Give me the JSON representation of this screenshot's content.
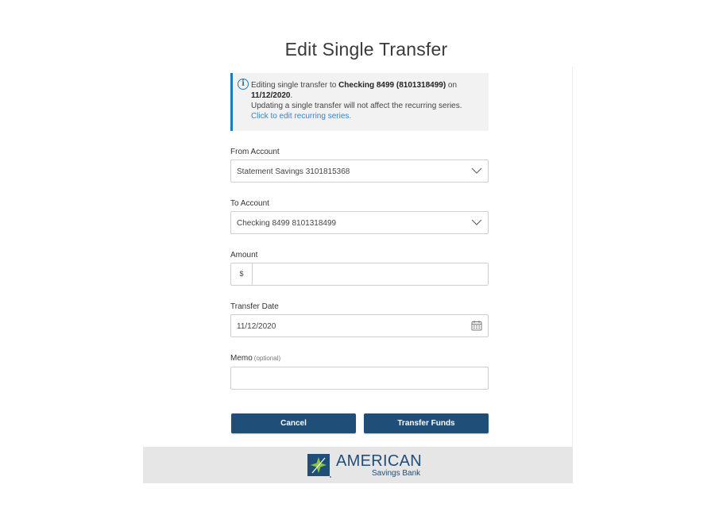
{
  "page": {
    "title": "Edit Single Transfer"
  },
  "notice": {
    "text_prefix": "Editing single transfer to ",
    "account_bold": "Checking 8499 (8101318499)",
    "text_on": " on",
    "date_bold": "11/12/2020",
    "period": ".",
    "line2": "Updating a single transfer will not affect the recurring series. ",
    "link": "Click to edit recurring series."
  },
  "form": {
    "from_label": "From Account",
    "from_value": "Statement Savings 3101815368",
    "to_label": "To Account",
    "to_value": "Checking 8499 8101318499",
    "amount_label": "Amount",
    "amount_prefix": "$",
    "amount_value": "",
    "date_label": "Transfer Date",
    "date_value": "11/12/2020",
    "memo_label": "Memo",
    "memo_optional": "(optional)",
    "memo_value": ""
  },
  "buttons": {
    "cancel": "Cancel",
    "submit": "Transfer Funds"
  },
  "footer": {
    "brand": "AMERICAN",
    "brand_sub": "Savings Bank"
  },
  "colors": {
    "primary": "#1f4e79",
    "info_accent": "#1b7ac1",
    "link": "#3b83c6",
    "logo_green": "#8cc63f"
  }
}
